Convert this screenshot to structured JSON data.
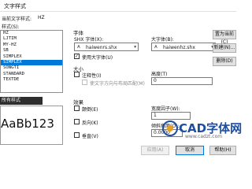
{
  "window": {
    "title": "文字样式"
  },
  "current_style": {
    "label": "当前文字样式:",
    "value": "HZ"
  },
  "styles": {
    "label": "样式(S):",
    "items": [
      "HZ",
      "LJTIM",
      "MY-HZ",
      "SB",
      "SIMPLEX",
      "SIMPLEX",
      "SONGTI",
      "STANDARD",
      "TEXTDE"
    ],
    "selected_index": 5
  },
  "preview": {
    "label": "所有样式",
    "sample_text": "AaBb123"
  },
  "font": {
    "group_label": "字体",
    "shx_label": "SHX 字体(X):",
    "shx_value": "haiwenrs.shx",
    "bigfont_label": "大字体(B):",
    "bigfont_value": "haiwenhz.shx",
    "use_bigfont_label": "使用大字体(U)",
    "use_bigfont_checked": true
  },
  "size": {
    "group_label": "大小",
    "annotative_label": "注释性(I)",
    "annotative_checked": false,
    "match_orientation_label": "使文字方向与布局匹配(M)",
    "height_label": "高度(T)",
    "height_value": "0"
  },
  "effects": {
    "group_label": "效果",
    "upside_down_label": "颠倒(E)",
    "backwards_label": "反向(K)",
    "vertical_label": "垂直(V)",
    "width_factor_label": "宽度因子(W):",
    "width_factor_value": "1",
    "oblique_label": "倾斜角度(O):",
    "oblique_value": "0.0000"
  },
  "buttons": {
    "set_current": "置为当前(C)",
    "new": "新建(N)...",
    "delete": "删除(D)",
    "apply": "应用(A)",
    "cancel": "取消",
    "help": "帮助(H)"
  },
  "watermark": {
    "text": "CAD字体网",
    "url": "www.cadzt.com"
  },
  "colors": {
    "selection": "#0078d7",
    "watermark": "#1f4e9e"
  }
}
